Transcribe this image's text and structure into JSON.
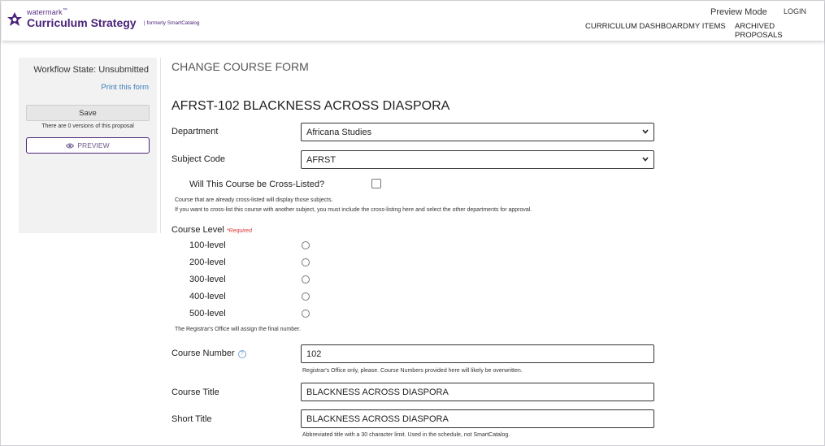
{
  "header": {
    "brand_small": "watermark",
    "brand_small_mark": "™",
    "brand_main": "Curriculum Strategy",
    "brand_formerly": "| formerly SmartCatalog",
    "preview_mode": "Preview Mode",
    "login": "LOGIN",
    "nav": {
      "dashboard": "CURRICULUM DASHBOARD",
      "my_items": "MY ITEMS",
      "archived": "ARCHIVED PROPOSALS"
    },
    "brand_color": "#4b2479"
  },
  "sidebar": {
    "workflow_state": "Workflow State: Unsubmitted",
    "print_link": "Print this form",
    "save_label": "Save",
    "versions_text": "There are 0 versions of this proposal",
    "preview_label": "PREVIEW",
    "preview_icon": "eye-icon"
  },
  "form": {
    "header": "CHANGE COURSE FORM",
    "course_heading": "AFRST-102 BLACKNESS ACROSS DIASPORA",
    "department": {
      "label": "Department",
      "value": "Africana Studies"
    },
    "subject_code": {
      "label": "Subject Code",
      "value": "AFRST"
    },
    "cross_listed": {
      "label": "Will This Course be Cross-Listed?",
      "checked": false,
      "note_1": "Course that are already cross-listed will display those subjects.",
      "note_2": "If you want to cross-list this course with another subject, you must include the cross-listing here and select the other departments for approval."
    },
    "course_level": {
      "label": "Course Level",
      "required": "*Required",
      "options": [
        "100-level",
        "200-level",
        "300-level",
        "400-level",
        "500-level"
      ],
      "note": "The Registrar's Office will assign the final number."
    },
    "course_number": {
      "label": "Course Number",
      "help_icon": "question-circle-icon",
      "value": "102",
      "note": "Registrar's Office only, please. Course Numbers provided here will likely be overwritten."
    },
    "course_title": {
      "label": "Course Title",
      "value": "BLACKNESS ACROSS DIASPORA"
    },
    "short_title": {
      "label": "Short Title",
      "value": "BLACKNESS ACROSS DIASPORA",
      "note": "Abbreviated title with a 30 character limit. Used in the schedule, not SmartCatalog."
    },
    "link_color": "#3b7ab8",
    "required_color": "#d33333"
  }
}
